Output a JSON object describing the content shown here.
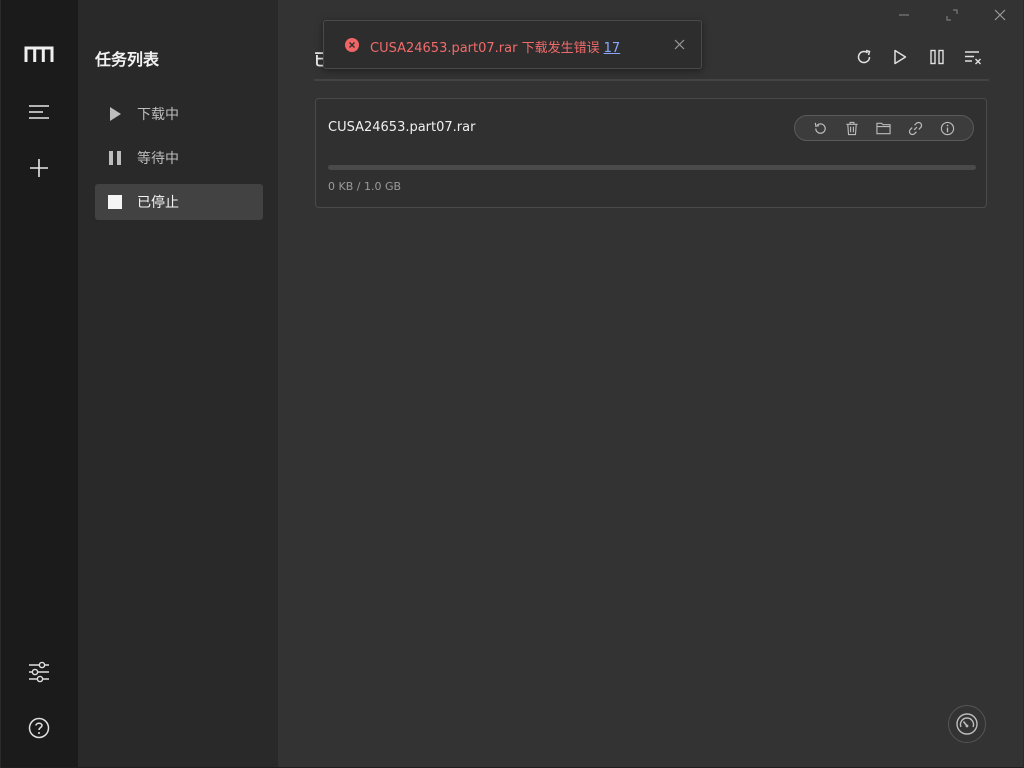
{
  "nav": {
    "title": "任务列表",
    "items": [
      {
        "label": "下载中",
        "icon": "play-icon"
      },
      {
        "label": "等待中",
        "icon": "pause-icon"
      },
      {
        "label": "已停止",
        "icon": "stop-icon"
      }
    ],
    "active_index": 2
  },
  "main": {
    "page_title_partial": "已"
  },
  "task": {
    "name": "CUSA24653.part07.rar",
    "size_text": "0 KB / 1.0 GB",
    "progress_percent": 0
  },
  "toast": {
    "message": "CUSA24653.part07.rar 下载发生错误",
    "count": "17"
  },
  "colors": {
    "error": "#f26b6b",
    "accent_link": "#8aa8ff"
  }
}
